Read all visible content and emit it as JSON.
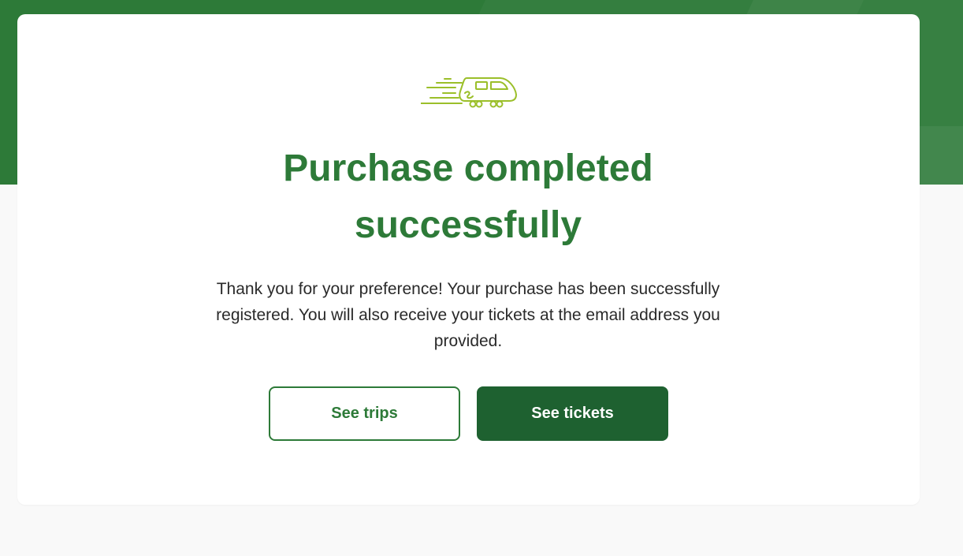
{
  "colors": {
    "brand_green": "#2d7a38",
    "button_dark_green": "#1e6130",
    "icon_lime": "#9bbf2a",
    "background": "#f9f9f9"
  },
  "confirmation": {
    "icon": "train-icon",
    "title": "Purchase completed successfully",
    "message": "Thank you for your preference! Your purchase has been successfully registered. You will also receive your tickets at the email address you provided."
  },
  "actions": {
    "see_trips_label": "See trips",
    "see_tickets_label": "See tickets"
  }
}
